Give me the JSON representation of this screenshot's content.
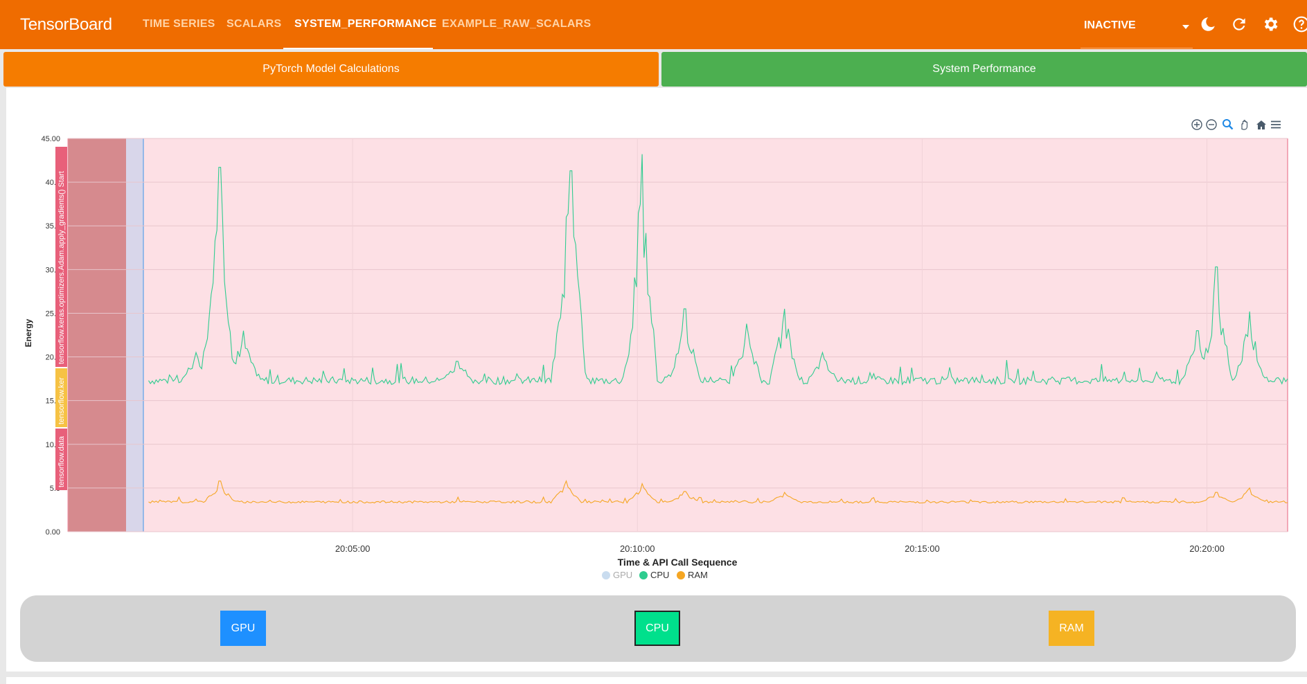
{
  "app": {
    "title": "TensorBoard"
  },
  "nav": {
    "tabs": [
      {
        "label": "TIME SERIES"
      },
      {
        "label": "SCALARS"
      },
      {
        "label": "SYSTEM_PERFORMANCE"
      },
      {
        "label": "EXAMPLE_RAW_SCALARS"
      }
    ],
    "active_tab": "SYSTEM_PERFORMANCE",
    "status_value": "INACTIVE",
    "icons": [
      "dark-mode-icon",
      "reload-icon",
      "settings-icon",
      "help-icon"
    ]
  },
  "sections": {
    "pytorch_label": "PyTorch Model Calculations",
    "system_label": "System Performance"
  },
  "colors": {
    "topbar": "#ef6c00",
    "pytorch_button": "#f57c00",
    "system_button": "#4caf50",
    "cpu": "#2ecc8f",
    "ram": "#f5a623",
    "gpu": "#c9dcef",
    "background_band": "#fde0e5",
    "api_band_dark": "#d68a8e"
  },
  "chart_data": {
    "type": "line",
    "title": "",
    "xlabel": "Time & API Call Sequence",
    "ylabel": "Energy",
    "ylim": [
      0,
      45
    ],
    "yticks": [
      "0.00",
      "5.0",
      "10.0",
      "15.0",
      "20.0",
      "25.0",
      "30.0",
      "35.0",
      "40.0",
      "45.00"
    ],
    "xticks": [
      "20:05:00",
      "20:10:00",
      "20:15:00",
      "20:20:00"
    ],
    "x_range": [
      "20:00:00",
      "20:21:25"
    ],
    "grid": true,
    "legend_placement": "bottom-center",
    "annotations": [
      {
        "label": "tensorflow.keras.optimizers.Adam.apply_gradients() Start",
        "color": "#e8607a"
      },
      {
        "label": "tensorflow.ker",
        "color": "#f6c244"
      },
      {
        "label": "tensorflow.data",
        "color": "#e8607a"
      }
    ],
    "series": [
      {
        "name": "GPU",
        "values": [],
        "hidden": true
      },
      {
        "name": "CPU",
        "baseline": 17.3,
        "peaks": [
          {
            "x": "20:02:40",
            "y": 41.7
          },
          {
            "x": "20:02:35",
            "y": 30.5
          },
          {
            "x": "20:03:05",
            "y": 23.0
          },
          {
            "x": "20:02:15",
            "y": 20.5
          },
          {
            "x": "20:06:50",
            "y": 19.5
          },
          {
            "x": "20:08:45",
            "y": 36.0
          },
          {
            "x": "20:08:50",
            "y": 41.3
          },
          {
            "x": "20:10:05",
            "y": 43.2
          },
          {
            "x": "20:10:00",
            "y": 28.0
          },
          {
            "x": "20:10:50",
            "y": 25.5
          },
          {
            "x": "20:11:55",
            "y": 23.8
          },
          {
            "x": "20:12:35",
            "y": 25.5
          },
          {
            "x": "20:13:15",
            "y": 20.5
          },
          {
            "x": "20:19:50",
            "y": 23.0
          },
          {
            "x": "20:20:10",
            "y": 30.3
          },
          {
            "x": "20:20:45",
            "y": 25.2
          }
        ]
      },
      {
        "name": "RAM",
        "baseline": 3.4,
        "peaks": [
          {
            "x": "20:02:40",
            "y": 5.8
          },
          {
            "x": "20:08:45",
            "y": 5.8
          },
          {
            "x": "20:10:05",
            "y": 5.5
          },
          {
            "x": "20:10:50",
            "y": 4.6
          },
          {
            "x": "20:12:35",
            "y": 4.5
          },
          {
            "x": "20:20:10",
            "y": 4.5
          },
          {
            "x": "20:20:45",
            "y": 5.0
          }
        ]
      }
    ],
    "legend": [
      {
        "name": "GPU",
        "color": "#c9dcef",
        "dimmed": true
      },
      {
        "name": "CPU",
        "color": "#2ecc8f",
        "dimmed": false
      },
      {
        "name": "RAM",
        "color": "#f5a623",
        "dimmed": false
      }
    ]
  },
  "chart_toolbar": [
    "zoom-in-icon",
    "zoom-out-icon",
    "selection-zoom-icon",
    "pan-icon",
    "reset-home-icon",
    "menu-icon"
  ],
  "toggles": [
    {
      "label": "GPU",
      "color": "#1e90ff"
    },
    {
      "label": "CPU",
      "color": "#00e08c"
    },
    {
      "label": "RAM",
      "color": "#f5b323"
    }
  ]
}
